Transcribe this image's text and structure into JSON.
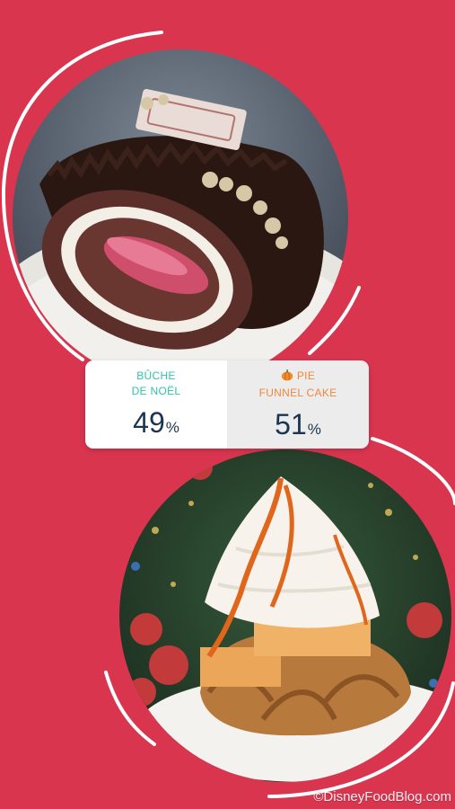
{
  "poll": {
    "option_left": {
      "line1": "BÛCHE",
      "line2": "DE NOËL",
      "percent": "49",
      "percent_sign": "%",
      "share": 0.49,
      "color": "#2fc2a9"
    },
    "option_right": {
      "icon": "pumpkin-icon",
      "line1": "PIE",
      "line2": "FUNNEL CAKE",
      "percent": "51",
      "percent_sign": "%",
      "share": 0.51,
      "color": "#f2863a"
    },
    "percent_color": "#1b3551"
  },
  "images": {
    "top": "buche-de-noel-photo",
    "bottom": "pumpkin-pie-funnel-cake-photo"
  },
  "watermark": "©DisneyFoodBlog.com",
  "colors": {
    "background": "#d9354f",
    "arc": "#ffffff"
  }
}
